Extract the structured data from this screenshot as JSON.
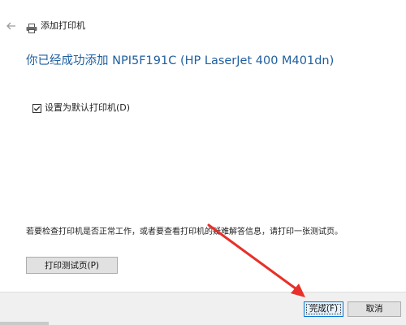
{
  "header": {
    "back_icon": "back-arrow-icon",
    "title_icon": "printer-icon",
    "title": "添加打印机"
  },
  "main": {
    "heading": "你已经成功添加 NPI5F191C (HP LaserJet 400 M401dn)",
    "default_printer": {
      "label": "设置为默认打印机(D)",
      "checked": true
    },
    "info_text": "若要检查打印机是否正常工作，或者要查看打印机的疑难解答信息，请打印一张测试页。",
    "test_page_label": "打印测试页(P)"
  },
  "footer": {
    "finish_label": "完成(F)",
    "cancel_label": "取消"
  },
  "annotation": {
    "arrow_color": "#e8302a"
  }
}
